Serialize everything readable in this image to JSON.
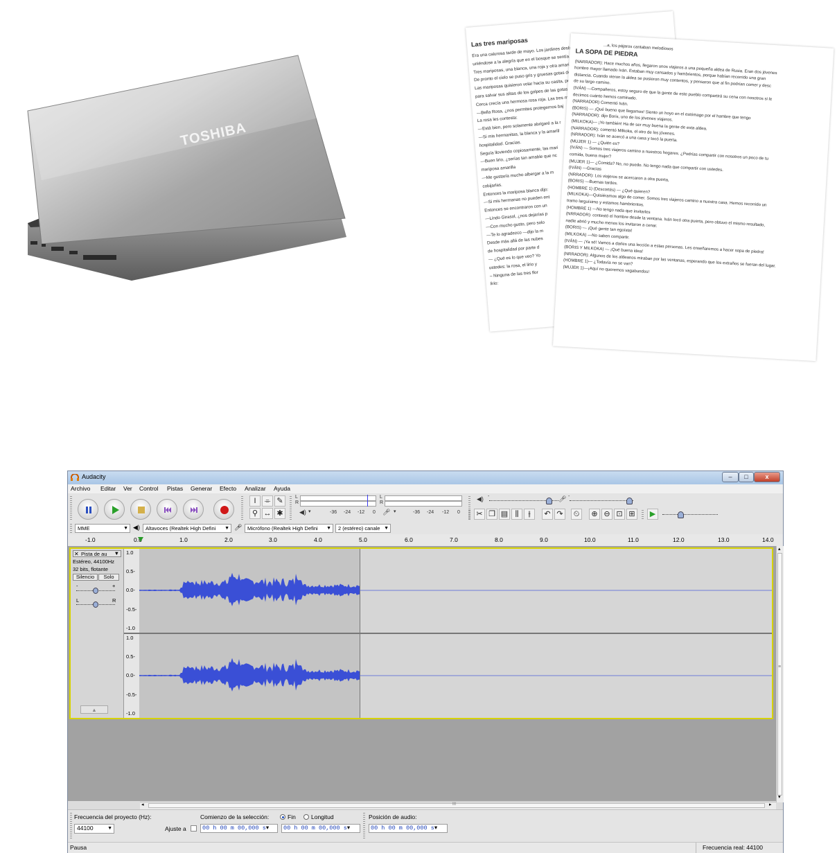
{
  "doc1": {
    "title": "Las tres mariposas",
    "lines": [
      "Era una calurosa tarde de mayo. Los jardines desbor",
      "uniéndose a la alegría que en el bosque se sentía.",
      "Tres mariposas, una blanca, una roja y otra amarill",
      "De pronto el cielo se puso gris y gruesas gotas de",
      "Las mariposas quisieron volar hacia su casita, pe",
      "para salvar sus alitas de los golpes de las gotas.",
      "Cerca crecía una hermosa rosa roja. Las tres m",
      "—Bella Rosa, ¿nos permites protegernos baj",
      "La rosa les contesta:",
      "—Está bien, pero solamente abrigaré a la r",
      "—Si mis hermanitas, la blanca y la amarill",
      "hospitalidad. Gracias.",
      "Seguía lloviendo copiosamente, las mari",
      "—Buen lirio, ¿serías tan amable que nc",
      "mariposa amarilla",
      "—Me gustaría mucho albergar a la m",
      "cobijarlas.",
      "Entonces la mariposa blanca dijo:",
      "—Si mis hermanas no pueden ent",
      "Entonces se encontraron con un",
      "—Lindo Girasol, ¿nos dejarías p",
      "—Con mucho gusto, pero solo",
      "—Te lo agradezco —dijo la m",
      "Desde más allá de las nubes",
      "de hospitalidad por parte d",
      "— ¿Qué es lo que veo? Yo",
      "ustedes: la rosa, el lirio y",
      "– Ninguna de las tres flor",
      "lirio:"
    ]
  },
  "doc2": {
    "header_fragment": "...a, los pájaros cantaban melodiosos",
    "title": "LA SOPA DE PIEDRA",
    "lines": [
      "(NARRADOR): Hace muchos años, llegaron unos viajeros a una pequeña aldea de Rusia. Eran dos jóvenes",
      "hombre mayor llamado  Iván. Estaban muy cansados y hambrientos, porque habían recorrido una gran",
      "distancia. Cuando vieron la aldea se pusieron muy contentos, y pensaron que al fin podrían comer  y desc",
      "de su largo camino.",
      "(IVÁN) —Compañeros, estoy seguro de que la gente de este pueblo compartirá su cena con nosotros si le",
      "decimos  cuánto hemos caminado.",
      "(NARRADOR) Comentó Iván.",
      "(BORIS) — ¡Qué bueno que llegamos! Siento un hoyo en el estómago por el hambre que tengo",
      "(NARRADOR): dijo Boris, uno de los jóvenes viajeros.",
      "(MILKOKA)— ¡Yo también! Ha de ser muy buena la gente de esta aldea.",
      "(NARRADOR): comentó Milkoka, el otro de los jóvenes.",
      "",
      "(NRRADOR): Iván se acercó a una casa y tocó la puerta.",
      "(MUJER 1) — ¿Quién es?",
      "(IVÁN)  — Somos tres viajeros camino a nuestros hogares. ¿Podrías compartir con nosotros un poco de tu",
      "comida, buena mujer?",
      "(MUJER 1)— ¿Comida? No, no puedo. No tengo nada que compartir con ustedes.",
      "(IVÁN) —Gracias",
      "",
      "(NRRADOR): Los viajeros se acercaron a otra puerta,",
      "(BORIS) —Buenas tardes.",
      "(HOMBRE 1) (Descortés) — ¿Qué quieren?",
      "(MILKOKA)—Quisiéramos algo de comer. Somos tres viajeros camino a nuestra casa. Hemos recorrido un",
      "tramo larguísimo y estamos hambrientos.",
      "(HOMBRE 1) —No tengo nada que invitarles",
      "(NRRADOR): contestó el hombre desde la ventana. Iván tocó otra puerta, pero obtuvo el mismo resultado,",
      "nadie abrió y mucho menos los invitaron a  cenar.",
      "(BORIS) — ¡Qué gente tan egoísta!",
      "(MILKOKA) —No saben compartir.",
      "(IVÁN) — ¡Ya sé! Vamos a darles una lección a estas personas. Les enseñaremos a hacer sopa de piedra!",
      "(BORIS Y MILKOKA) — ¡Qué buena idea!",
      "",
      "(NRRADOR): Algunos de los aldeanos miraban por las ventanas, esperando que los extraños se fueran del lugar.",
      "(HOMBRE 1)— ¿Todavía no se van?",
      "(MUJER 1)—¡Aquí no queremos vagabundos!"
    ]
  },
  "laptop": {
    "brand": "TOSHIBA"
  },
  "audacity": {
    "title": "Audacity",
    "window_buttons": {
      "minimize": "–",
      "maximize": "□",
      "close": "x"
    },
    "menu": [
      "Archivo",
      "Editar",
      "Ver",
      "Control",
      "Pistas",
      "Generar",
      "Efecto",
      "Analizar",
      "Ayuda"
    ],
    "meters": {
      "left": "L",
      "right": "R",
      "db_ticks_play": [
        "-36",
        "-24",
        "-12",
        "0"
      ],
      "db_ticks_rec": [
        "-36",
        "-24",
        "-12",
        "0"
      ]
    },
    "mixer": {
      "minus": "-",
      "plus": "+"
    },
    "device": {
      "host": "MME",
      "output": "Altavoces (Realtek High Defini",
      "input": "Micrófono (Realtek High Defini",
      "channels": "2 (estéreo) canale"
    },
    "ruler": [
      "-1.0",
      "0.0",
      "1.0",
      "2.0",
      "3.0",
      "4.0",
      "5.0",
      "6.0",
      "7.0",
      "8.0",
      "9.0",
      "10.0",
      "11.0",
      "12.0",
      "13.0",
      "14.0"
    ],
    "track": {
      "name": "Pista de au",
      "close": "✕",
      "format1": "Estéreo, 44100Hz",
      "format2": "32 bits, flotante",
      "mute": "Silencio",
      "solo": "Solo",
      "gain_minus": "-",
      "gain_plus": "+",
      "pan_left": "L",
      "pan_right": "R",
      "collapse": "▲",
      "scale": [
        "1.0",
        "0.5-",
        "0.0-",
        "-0.5-",
        "-1.0"
      ]
    },
    "scroll": {
      "left": "◂",
      "right": "▸",
      "up": "▴",
      "down": "▾",
      "grip": "III",
      "vgrip": "≡"
    },
    "selection": {
      "rate_label": "Frecuencia del proyecto (Hz):",
      "rate_value": "44100",
      "snap_label": "Ajuste a",
      "start_label": "Comienzo de la selección:",
      "end_option": "Fin",
      "length_option": "Longitud",
      "start_time": "00 h 00 m 00,000 s",
      "end_time": "00 h 00 m 00,000 s",
      "pos_label": "Posición de audio:",
      "pos_time": "00 h 00 m 00,000 s"
    },
    "status": {
      "left": "Pausa",
      "right": "Frecuencia real: 44100"
    },
    "colors": {
      "waveform": "#3a4fd6",
      "track_border": "#d6d200",
      "selection": "#c4c4c4"
    }
  }
}
